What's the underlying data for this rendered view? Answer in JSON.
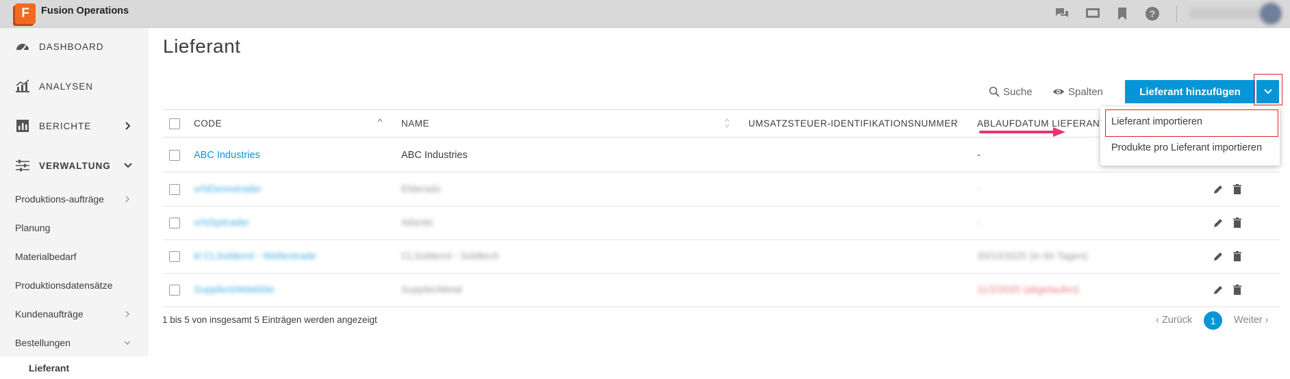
{
  "app": {
    "logo_letter": "F",
    "title": "Fusion Operations"
  },
  "topbar_icons": [
    "chat-icon",
    "display-icon",
    "bookmark-icon",
    "help-icon"
  ],
  "sidebar": {
    "main": [
      {
        "label": "DASHBOARD",
        "icon": "dashboard-icon"
      },
      {
        "label": "ANALYSEN",
        "icon": "analytics-icon"
      },
      {
        "label": "BERICHTE",
        "icon": "reports-icon"
      },
      {
        "label": "VERWALTUNG",
        "icon": "sliders-icon"
      }
    ],
    "sub": [
      "Produktions-aufträge",
      "Planung",
      "Materialbedarf",
      "Produktionsdatensätze",
      "Kundenaufträge",
      "Bestellungen"
    ],
    "active": "Lieferant"
  },
  "page": {
    "title": "Lieferant",
    "search_label": "Suche",
    "columns_label": "Spalten",
    "add_button": "Lieferant hinzufügen"
  },
  "table": {
    "headers": {
      "code": "CODE",
      "name": "NAME",
      "vat": "UMSATZSTEUER-IDENTIFIKATIONSNUMMER",
      "expiry": "ABLAUFDATUM LIEFERANTE"
    },
    "rows": [
      {
        "code": "ABC Industries",
        "name": "ABC Industries",
        "expiry": "-"
      },
      {
        "code": "vrNDemotrader",
        "name": "Elderado",
        "expiry": "-"
      },
      {
        "code": "vrNSpitrader",
        "name": "Atlantic",
        "expiry": "-"
      },
      {
        "code": "kl CLSolderrd - Weltentrade",
        "name": "CLSolderrd - Soldtech",
        "expiry": "30/10/2025 (in 60 Tagen)"
      },
      {
        "code": "SuppliertrMdebble",
        "name": "SupplierMetal",
        "expiry": "11/2/2025 (abgelaufen)"
      }
    ]
  },
  "footer": {
    "info": "1 bis 5 von insgesamt 5 Einträgen werden angezeigt",
    "prev": "Zurück",
    "current_page": "1",
    "next": "Weiter"
  },
  "dropdown": {
    "items": [
      "Lieferant importieren",
      "Produkte pro Lieferant importieren"
    ]
  },
  "colors": {
    "accent": "#0696d7",
    "brand": "#f26a21",
    "highlight": "#e02020",
    "arrow": "#e8336b",
    "expired": "#e05050"
  }
}
